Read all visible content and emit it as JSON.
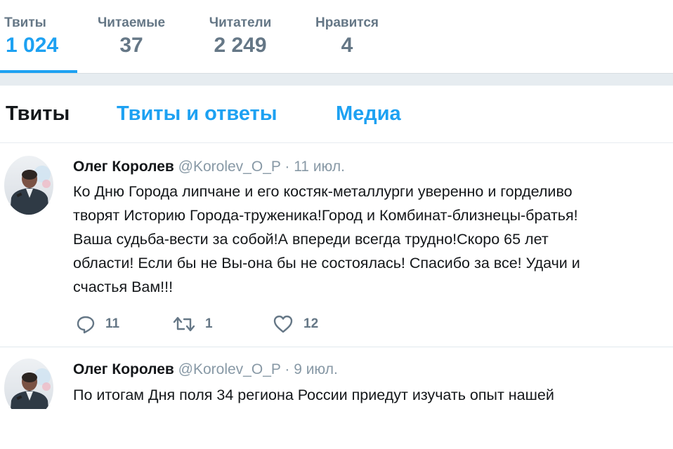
{
  "profile_nav": {
    "items": [
      {
        "label": "Твиты",
        "value": "1 024",
        "active": true
      },
      {
        "label": "Читаемые",
        "value": "37"
      },
      {
        "label": "Читатели",
        "value": "2 249"
      },
      {
        "label": "Нравится",
        "value": "4"
      }
    ]
  },
  "tabs": {
    "tweets": "Твиты",
    "tweets_replies": "Твиты и ответы",
    "media": "Медиа"
  },
  "tweets": [
    {
      "name": "Олег Королев",
      "handle": "@Korolev_O_P",
      "separator": "·",
      "date": "11 июл.",
      "lines": [
        "Ко Дню Города липчане и его костяк-металлурги уверенно и горделиво",
        "творят Историю Города-труженика!Город и Комбинат-близнецы-братья!",
        "Ваша судьба-вести за собой!А впереди всегда трудно!Скоро 65 лет",
        "области! Если бы не Вы-она бы не состоялась! Спасибо за все! Удачи и",
        "счастья Вам!!!"
      ],
      "replies": "11",
      "retweets": "1",
      "likes": "12"
    },
    {
      "name": "Олег Королев",
      "handle": "@Korolev_O_P",
      "separator": "·",
      "date": "9 июл.",
      "lines": [
        "По итогам Дня поля 34 региона России приедут изучать опыт нашей"
      ]
    }
  ],
  "icons": {
    "reply": "reply-icon",
    "retweet": "retweet-icon",
    "like": "heart-icon"
  },
  "colors": {
    "accent": "#1da1f2",
    "muted": "#657786",
    "text": "#14171a"
  }
}
